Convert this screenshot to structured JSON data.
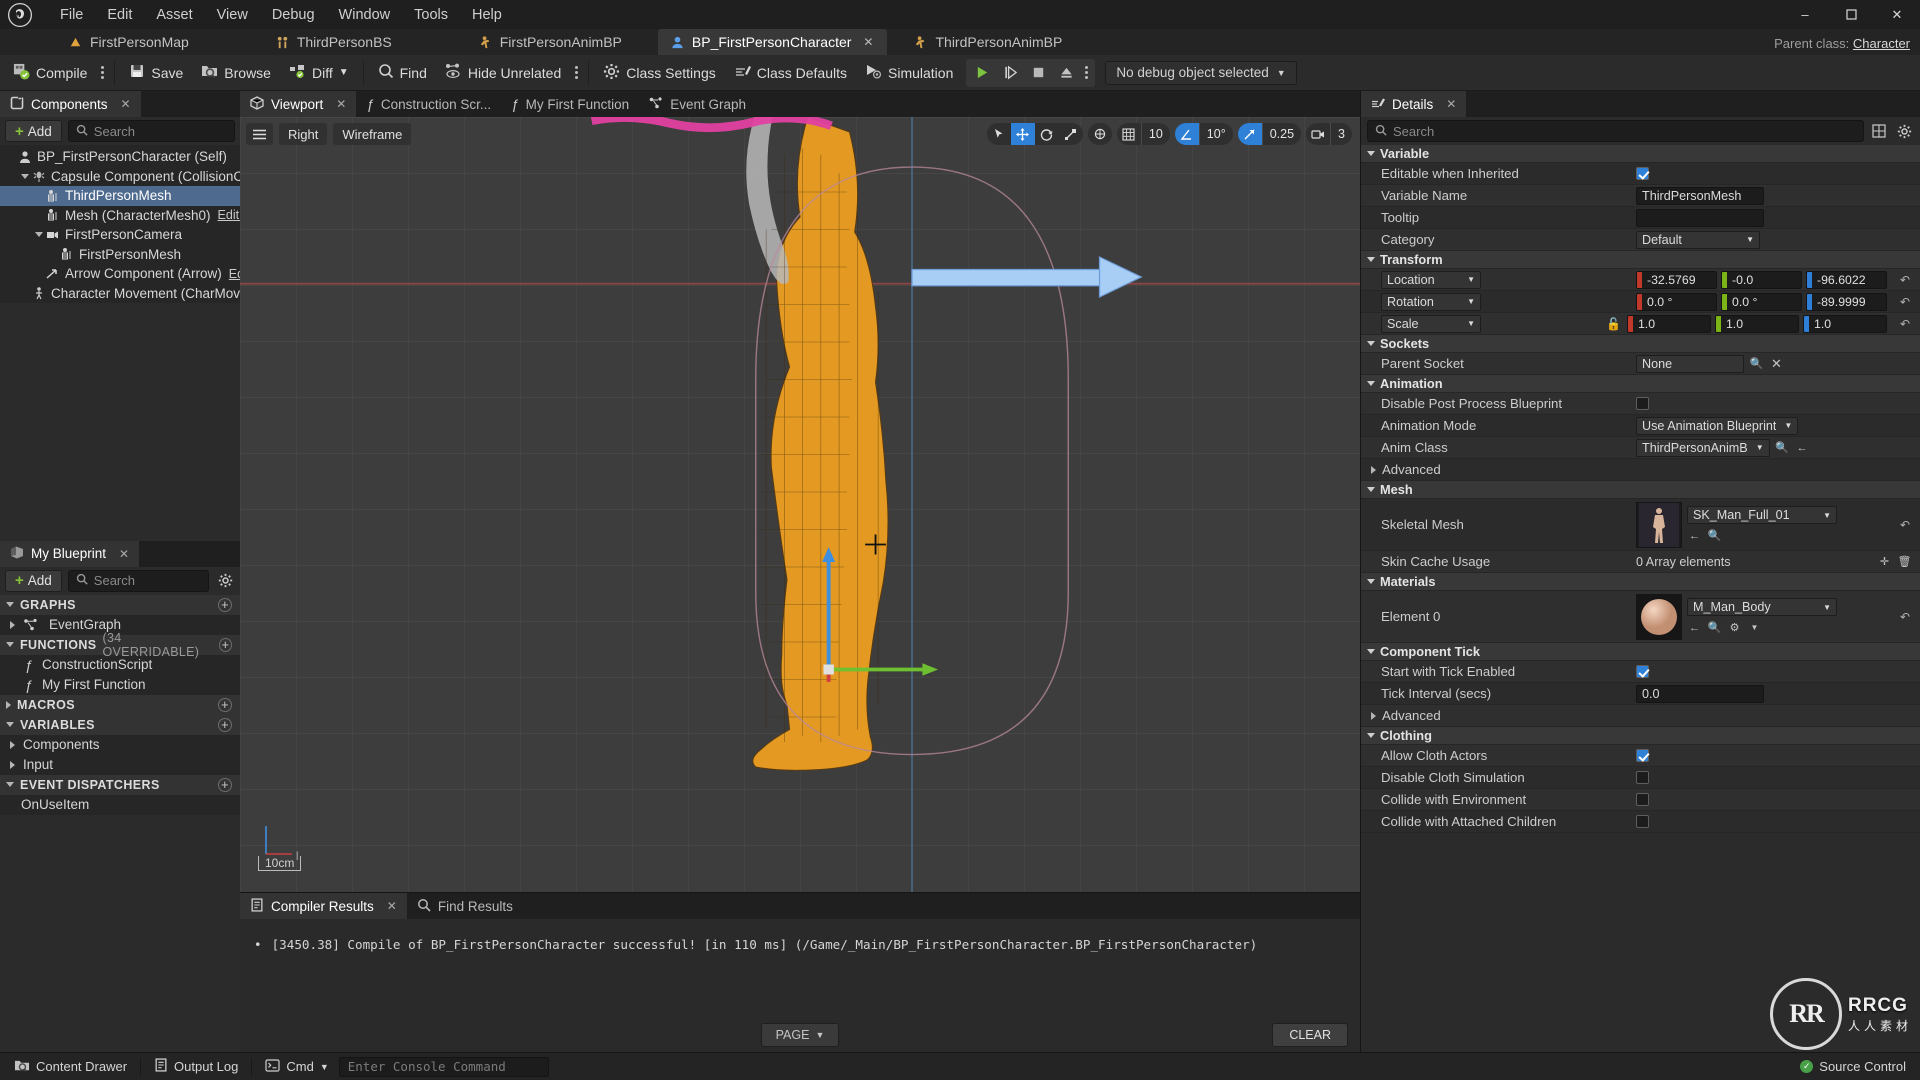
{
  "app": {
    "logo": "unreal-engine-logo",
    "menu": [
      "File",
      "Edit",
      "Asset",
      "View",
      "Debug",
      "Window",
      "Tools",
      "Help"
    ],
    "window_controls": {
      "minimize": "–",
      "maximize": "❐",
      "close": "✕"
    }
  },
  "asset_tabs": [
    {
      "label": "FirstPersonMap",
      "icon": "map-icon",
      "active": false,
      "closable": false
    },
    {
      "label": "ThirdPersonBS",
      "icon": "blendspace-icon",
      "active": false,
      "closable": false
    },
    {
      "label": "FirstPersonAnimBP",
      "icon": "animbp-icon",
      "active": false,
      "closable": false
    },
    {
      "label": "BP_FirstPersonCharacter",
      "icon": "blueprint-character-icon",
      "active": true,
      "closable": true
    },
    {
      "label": "ThirdPersonAnimBP",
      "icon": "animbp-icon",
      "active": false,
      "closable": false
    }
  ],
  "parent_class": {
    "label": "Parent class:",
    "value": "Character"
  },
  "toolbar": {
    "compile": "Compile",
    "save": "Save",
    "browse": "Browse",
    "diff": "Diff",
    "find": "Find",
    "hide_unrelated": "Hide Unrelated",
    "class_settings": "Class Settings",
    "class_defaults": "Class Defaults",
    "simulation": "Simulation",
    "play": "play-icon",
    "step": "step-icon",
    "stop": "stop-icon",
    "eject": "eject-icon",
    "debug_object": "No debug object selected"
  },
  "components_panel": {
    "tab_label": "Components",
    "add_label": "Add",
    "search_placeholder": "Search",
    "tree": [
      {
        "label": "BP_FirstPersonCharacter (Self)",
        "indent": 0,
        "icon": "character-icon",
        "twisty": "none",
        "selected": false,
        "edit_cpp": ""
      },
      {
        "label": "Capsule Component (CollisionCylinder)",
        "indent": 1,
        "icon": "capsule-icon",
        "twisty": "down",
        "selected": false,
        "edit_cpp": ""
      },
      {
        "label": "ThirdPersonMesh",
        "indent": 2,
        "icon": "skeletal-mesh-icon",
        "twisty": "none",
        "selected": true,
        "edit_cpp": ""
      },
      {
        "label": "Mesh (CharacterMesh0)",
        "indent": 2,
        "icon": "skeletal-mesh-icon",
        "twisty": "none",
        "selected": false,
        "edit_cpp": "Edit in C++"
      },
      {
        "label": "FirstPersonCamera",
        "indent": 2,
        "icon": "camera-icon",
        "twisty": "down",
        "selected": false,
        "edit_cpp": ""
      },
      {
        "label": "FirstPersonMesh",
        "indent": 3,
        "icon": "skeletal-mesh-icon",
        "twisty": "none",
        "selected": false,
        "edit_cpp": ""
      },
      {
        "label": "Arrow Component (Arrow)",
        "indent": 2,
        "icon": "arrow-component-icon",
        "twisty": "none",
        "selected": false,
        "edit_cpp": "Edit in C++"
      },
      {
        "label": "Character Movement (CharMoveComp)",
        "indent": 1,
        "icon": "movement-icon",
        "twisty": "none",
        "selected": false,
        "edit_cpp": ""
      }
    ]
  },
  "my_blueprint_panel": {
    "tab_label": "My Blueprint",
    "add_label": "Add",
    "search_placeholder": "Search",
    "settings_icon": "gear-icon",
    "sections": [
      {
        "title": "GRAPHS",
        "sub": "",
        "expanded": true,
        "items": [
          {
            "label": "EventGraph",
            "icon": "graph-icon",
            "twisty": "right"
          }
        ]
      },
      {
        "title": "FUNCTIONS",
        "sub": "(34 OVERRIDABLE)",
        "expanded": true,
        "items": [
          {
            "label": "ConstructionScript",
            "icon": "function-icon",
            "twisty": "none"
          },
          {
            "label": "My First Function",
            "icon": "function-icon",
            "twisty": "none"
          }
        ]
      },
      {
        "title": "MACROS",
        "sub": "",
        "expanded": false,
        "items": []
      },
      {
        "title": "VARIABLES",
        "sub": "",
        "expanded": true,
        "items": [
          {
            "label": "Components",
            "icon": "",
            "twisty": "right"
          },
          {
            "label": "Input",
            "icon": "",
            "twisty": "right"
          }
        ]
      },
      {
        "title": "EVENT DISPATCHERS",
        "sub": "",
        "expanded": true,
        "items": [
          {
            "label": "OnUseItem",
            "icon": "",
            "twisty": "none"
          }
        ]
      }
    ]
  },
  "editor_tabs": [
    {
      "label": "Viewport",
      "icon": "viewport-icon",
      "active": true,
      "closable": true
    },
    {
      "label": "Construction Scr...",
      "icon": "function-icon",
      "active": false,
      "closable": false
    },
    {
      "label": "My First Function",
      "icon": "function-icon",
      "active": false,
      "closable": false
    },
    {
      "label": "Event Graph",
      "icon": "graph-icon",
      "active": false,
      "closable": false
    }
  ],
  "viewport": {
    "menu_icon": "hamburger-icon",
    "view_mode": "Right",
    "shading_mode": "Wireframe",
    "tools": [
      "select-icon",
      "translate-icon",
      "rotate-icon",
      "scale-icon"
    ],
    "world_icon": "coordinate-system-icon",
    "grid_snap": "10",
    "angle_snap": "10°",
    "scale_snap": "0.25",
    "camera_speed": "3",
    "scale_indicator": "10cm"
  },
  "results_panel": {
    "tabs": [
      {
        "label": "Compiler Results",
        "icon": "compiler-icon",
        "active": true,
        "closable": true
      },
      {
        "label": "Find Results",
        "icon": "search-icon",
        "active": false,
        "closable": false
      }
    ],
    "message": "[3450.38] Compile of BP_FirstPersonCharacter successful! [in 110 ms] (/Game/_Main/BP_FirstPersonCharacter.BP_FirstPersonCharacter)",
    "page_label": "PAGE",
    "clear_label": "CLEAR"
  },
  "details_panel": {
    "tab_label": "Details",
    "search_placeholder": "Search",
    "grid_view_icon": "grid-view-icon",
    "settings_icon": "gear-icon",
    "categories": [
      {
        "name": "Variable",
        "expanded": true,
        "rows": [
          {
            "label": "Editable when Inherited",
            "type": "checkbox",
            "value": true
          },
          {
            "label": "Variable Name",
            "type": "text",
            "value": "ThirdPersonMesh"
          },
          {
            "label": "Tooltip",
            "type": "text",
            "value": ""
          },
          {
            "label": "Category",
            "type": "combo",
            "value": "Default"
          }
        ]
      },
      {
        "name": "Transform",
        "expanded": true,
        "rows": [
          {
            "label": "Location",
            "type": "vector",
            "x": "-32.5769",
            "y": "-0.0",
            "z": "-96.6022"
          },
          {
            "label": "Rotation",
            "type": "vector",
            "x": "0.0 °",
            "y": "0.0 °",
            "z": "-89.9999"
          },
          {
            "label": "Scale",
            "type": "vector",
            "x": "1.0",
            "y": "1.0",
            "z": "1.0",
            "lock": "lock-open-icon"
          }
        ]
      },
      {
        "name": "Sockets",
        "expanded": true,
        "rows": [
          {
            "label": "Parent Socket",
            "type": "socket",
            "value": "None"
          }
        ]
      },
      {
        "name": "Animation",
        "expanded": true,
        "rows": [
          {
            "label": "Disable Post Process Blueprint",
            "type": "checkbox",
            "value": false
          },
          {
            "label": "Animation Mode",
            "type": "combo",
            "value": "Use Animation Blueprint"
          },
          {
            "label": "Anim Class",
            "type": "asset",
            "value": "ThirdPersonAnimB"
          },
          {
            "label": "Advanced",
            "type": "subgroup",
            "value": ""
          }
        ]
      },
      {
        "name": "Mesh",
        "expanded": true,
        "rows": [
          {
            "label": "Skeletal Mesh",
            "type": "thumb-asset",
            "value": "SK_Man_Full_01",
            "thumb": "mannequin-thumb"
          },
          {
            "label": "Skin Cache Usage",
            "type": "array",
            "value": "0 Array elements"
          }
        ]
      },
      {
        "name": "Materials",
        "expanded": true,
        "rows": [
          {
            "label": "Element 0",
            "type": "thumb-asset",
            "value": "M_Man_Body",
            "thumb": "material-sphere-thumb"
          }
        ]
      },
      {
        "name": "Component Tick",
        "expanded": true,
        "rows": [
          {
            "label": "Start with Tick Enabled",
            "type": "checkbox",
            "value": true
          },
          {
            "label": "Tick Interval (secs)",
            "type": "text",
            "value": "0.0"
          },
          {
            "label": "Advanced",
            "type": "subgroup",
            "value": ""
          }
        ]
      },
      {
        "name": "Clothing",
        "expanded": true,
        "rows": [
          {
            "label": "Allow Cloth Actors",
            "type": "checkbox",
            "value": true
          },
          {
            "label": "Disable Cloth Simulation",
            "type": "checkbox",
            "value": false
          },
          {
            "label": "Collide with Environment",
            "type": "checkbox",
            "value": false
          },
          {
            "label": "Collide with Attached Children",
            "type": "checkbox",
            "value": false
          }
        ]
      }
    ]
  },
  "status_bar": {
    "content_drawer": "Content Drawer",
    "output_log": "Output Log",
    "cmd": "Cmd",
    "console_placeholder": "Enter Console Command",
    "source_control": "Source Control"
  },
  "watermark": {
    "badge": "RR",
    "title": "RRCG",
    "sub": "人人素材"
  },
  "colors": {
    "accent_blue": "#2f81d8",
    "selection": "#4e6a8e",
    "axis_x": "#c0392b",
    "axis_y": "#7cb518",
    "axis_z": "#2f7fd8",
    "compile_green": "#86c33b",
    "panel_bg": "#2b2b2b",
    "viewport_bg": "#3d3d3d"
  }
}
